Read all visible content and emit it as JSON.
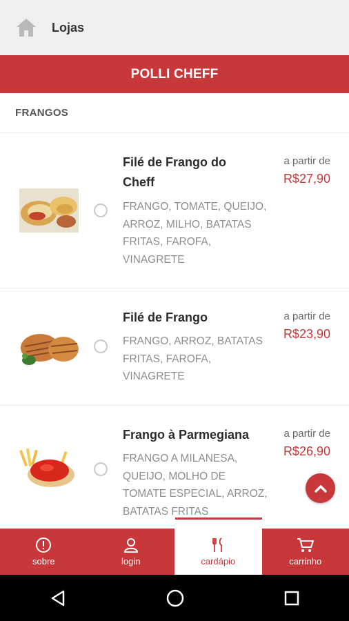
{
  "header": {
    "title": "Lojas",
    "icon": "home-icon"
  },
  "store": {
    "name": "POLLI CHEFF",
    "brand_color": "#c8383b"
  },
  "category": {
    "label": "FRANGOS"
  },
  "items": [
    {
      "name": "Filé de Frango do Cheff",
      "description": "FRANGO, TOMATE, QUEIJO, ARROZ, MILHO, BATATAS FRITAS, FAROFA, VINAGRETE",
      "price_prefix": "a partir de",
      "price": "R$27,90"
    },
    {
      "name": "Filé de Frango",
      "description": "FRANGO, ARROZ, BATATAS FRITAS, FAROFA, VINAGRETE",
      "price_prefix": "a partir de",
      "price": "R$23,90"
    },
    {
      "name": "Frango à Parmegiana",
      "description": "FRANGO A MILANESA, QUEIJO, MOLHO DE TOMATE ESPECIAL, ARROZ, BATATAS FRITAS",
      "price_prefix": "a partir de",
      "price": "R$26,90"
    }
  ],
  "tabs": [
    {
      "label": "sobre",
      "icon": "info-icon",
      "active": false
    },
    {
      "label": "login",
      "icon": "user-icon",
      "active": false
    },
    {
      "label": "cardápio",
      "icon": "cutlery-icon",
      "active": true
    },
    {
      "label": "carrinho",
      "icon": "cart-icon",
      "active": false
    }
  ],
  "system_nav": [
    "back-icon",
    "home-circle-icon",
    "recents-icon"
  ]
}
